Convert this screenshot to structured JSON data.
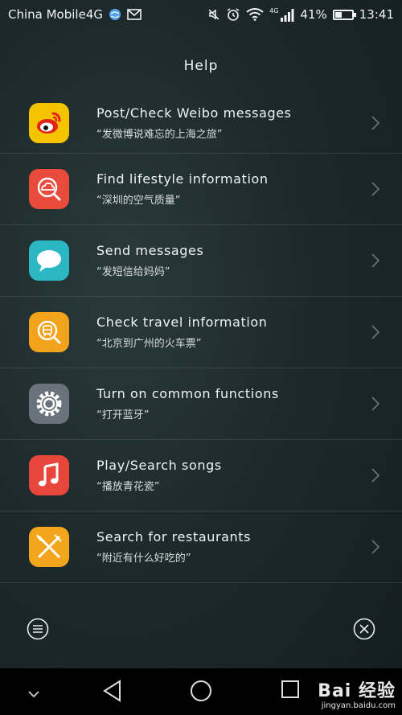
{
  "statusbar": {
    "carrier": "China Mobile4G",
    "network": "4G",
    "battery_percent": "41%",
    "battery_level": 0.41,
    "time": "13:41"
  },
  "header": {
    "title": "Help"
  },
  "items": [
    {
      "title": "Post/Check Weibo messages",
      "subtitle": "“发微博说难忘的上海之旅”",
      "icon": "weibo-icon",
      "color": "#f5c400"
    },
    {
      "title": "Find lifestyle information",
      "subtitle": "“深圳的空气质量”",
      "icon": "lifestyle-search-icon",
      "color": "#e84a3b"
    },
    {
      "title": "Send messages",
      "subtitle": "“发短信给妈妈”",
      "icon": "message-bubble-icon",
      "color": "#2bb7c4"
    },
    {
      "title": "Check travel information",
      "subtitle": "“北京到广州的火车票”",
      "icon": "train-search-icon",
      "color": "#f2a21b"
    },
    {
      "title": "Turn on common functions",
      "subtitle": "“打开蓝牙”",
      "icon": "settings-gear-icon",
      "color": "#6a737c"
    },
    {
      "title": "Play/Search songs",
      "subtitle": "“播放青花瓷”",
      "icon": "music-note-icon",
      "color": "#e8453b"
    },
    {
      "title": "Search for restaurants",
      "subtitle": "“附近有什么好吃的”",
      "icon": "fork-knife-icon",
      "color": "#f3a51c"
    }
  ],
  "watermark": {
    "brand": "Bai 经验",
    "url": "jingyan.baidu.com"
  }
}
